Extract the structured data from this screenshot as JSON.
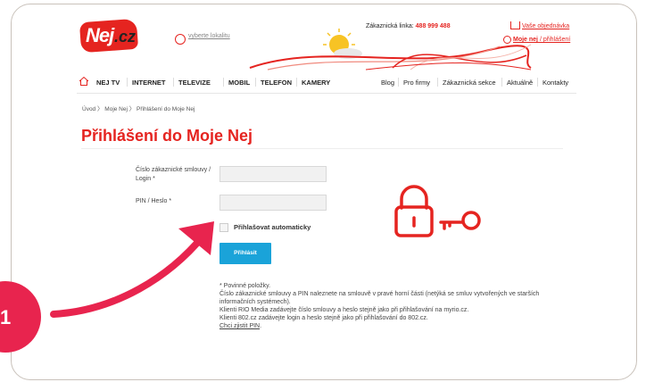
{
  "header": {
    "logo_text": "Nej",
    "logo_suffix": ".cz",
    "location_link": "vyberte lokalitu",
    "hotline_label": "Zákaznická linka:",
    "hotline_number": "488 999 488",
    "orders_link": "Vaše objednávka",
    "login_link_bold": "Moje nej",
    "login_link_rest": " / přihlášení"
  },
  "nav": {
    "left": [
      "NEJ TV",
      "INTERNET",
      "TELEVIZE",
      "MOBIL",
      "TELEFON",
      "KAMERY"
    ],
    "right": [
      "Blog",
      "Pro firmy",
      "Zákaznická sekce",
      "Aktuálně",
      "Kontakty"
    ]
  },
  "breadcrumb": "Úvod 〉 Moje Nej 〉 Přihlášení do Moje Nej",
  "page_title": "Přihlášení do Moje Nej",
  "form": {
    "login_label_line1": "Číslo zákaznické smlouvy /",
    "login_label_line2": "Login *",
    "pin_label": "PIN / Heslo *",
    "autologin_label": "Přihlašovat automaticky",
    "submit_label": "Přihlásit"
  },
  "notes": [
    "* Povinné položky.",
    "Číslo zákaznické smlouvy a PIN naleznete na smlouvě v pravé horní části (netýká se smluv vytvořených ve starších",
    "informačních systémech).",
    "Klienti RIO Media zadávejte číslo smlouvy a heslo stejně jako při přihlašování na myrio.cz.",
    "Klienti 802.cz zadávejte login a heslo stejně jako při přihlašování do 802.cz."
  ],
  "pin_link": "Chci zjistit PIN",
  "pin_link_suffix": ".",
  "step_badge": "1",
  "colors": {
    "brand": "#e52420",
    "button": "#1aa3d9",
    "badge": "#e8244e"
  }
}
